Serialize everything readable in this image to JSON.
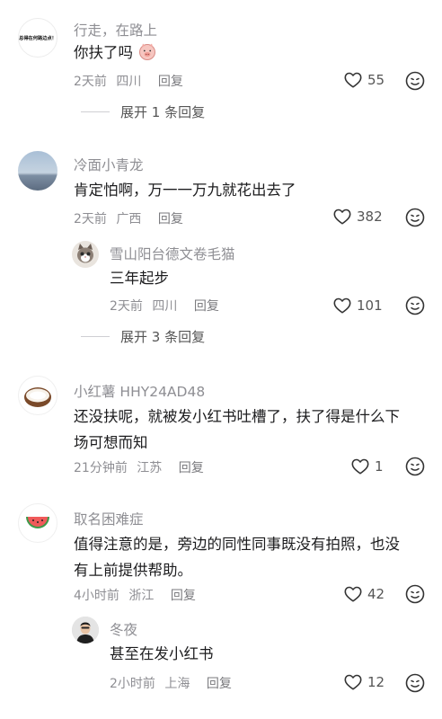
{
  "comments": [
    {
      "author": "行走，在路上",
      "avatar_text": "总得在何路边点！",
      "text": "你扶了吗",
      "time": "2天前",
      "location": "四川",
      "reply_label": "回复",
      "likes": "55",
      "expand_label": "展开 1 条回复",
      "replies": []
    },
    {
      "author": "冷面小青龙",
      "text": "肯定怕啊，万一一万九就花出去了",
      "time": "2天前",
      "location": "广西",
      "reply_label": "回复",
      "likes": "382",
      "expand_label": "展开 3 条回复",
      "replies": [
        {
          "author": "雪山阳台德文卷毛猫",
          "text": "三年起步",
          "time": "2天前",
          "location": "四川",
          "reply_label": "回复",
          "likes": "101"
        }
      ]
    },
    {
      "author": "小红薯 HHY24AD48",
      "text_line1": "还没扶呢，就被发小红书吐槽了，扶了得是什么下",
      "text_line2": "场可想而知",
      "time": "21分钟前",
      "location": "江苏",
      "reply_label": "回复",
      "likes": "1",
      "replies": []
    },
    {
      "author": "取名困难症",
      "text_line1": "值得注意的是，旁边的同性同事既没有拍照，也没",
      "text_line2": "有上前提供帮助。",
      "time": "4小时前",
      "location": "浙江",
      "reply_label": "回复",
      "likes": "42",
      "replies": [
        {
          "author": "冬夜",
          "text": "甚至在发小红书",
          "time": "2小时前",
          "location": "上海",
          "reply_label": "回复",
          "likes": "12"
        }
      ]
    }
  ],
  "colors": {
    "secondary_text": "#8e8e93",
    "primary_text": "#1c1c1e",
    "background": "#ffffff"
  },
  "icons": {
    "like": "heart-outline-icon",
    "emoji": "emoji-face-icon"
  }
}
